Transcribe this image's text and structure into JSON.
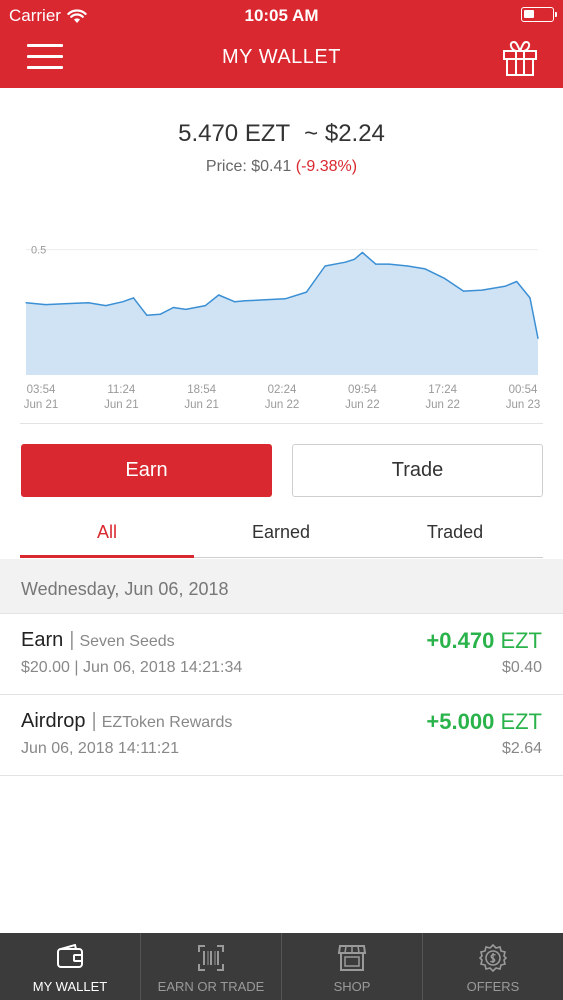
{
  "status_bar": {
    "carrier": "Carrier",
    "time": "10:05 AM"
  },
  "nav": {
    "title": "MY WALLET",
    "menu_icon": "hamburger-menu-icon",
    "right_icon": "gift-icon"
  },
  "balance": {
    "amount": "5.470 EZT",
    "fiat": "~ $2.24"
  },
  "price": {
    "label": "Price: $0.41",
    "change": "(-9.38%)"
  },
  "chart_data": {
    "type": "area",
    "title": "",
    "xlabel": "",
    "ylabel": "",
    "y_ticks": [
      "0.5",
      "0.4"
    ],
    "ylim": [
      0.37,
      0.51
    ],
    "x_ticks": [
      {
        "time": "03:54",
        "date": "Jun 21"
      },
      {
        "time": "11:24",
        "date": "Jun 21"
      },
      {
        "time": "18:54",
        "date": "Jun 21"
      },
      {
        "time": "02:24",
        "date": "Jun 22"
      },
      {
        "time": "09:54",
        "date": "Jun 22"
      },
      {
        "time": "17:24",
        "date": "Jun 22"
      },
      {
        "time": "00:54",
        "date": "Jun 23"
      }
    ],
    "x": [
      "Jun 21 03:54",
      "Jun 21 05:45",
      "Jun 21 07:45",
      "Jun 21 09:45",
      "Jun 21 11:24",
      "Jun 21 13:00",
      "Jun 21 14:00",
      "Jun 21 15:15",
      "Jun 21 16:30",
      "Jun 21 17:45",
      "Jun 21 18:54",
      "Jun 21 20:45",
      "Jun 21 22:00",
      "Jun 21 23:30",
      "Jun 22 00:30",
      "Jun 22 02:24",
      "Jun 22 04:15",
      "Jun 22 06:15",
      "Jun 22 08:00",
      "Jun 22 09:54",
      "Jun 22 10:45",
      "Jun 22 11:30",
      "Jun 22 12:45",
      "Jun 22 14:00",
      "Jun 22 15:45",
      "Jun 22 17:24",
      "Jun 22 19:15",
      "Jun 22 21:00",
      "Jun 22 22:45",
      "Jun 23 00:54",
      "Jun 23 02:00",
      "Jun 23 03:15",
      "Jun 23 04:00"
    ],
    "values": [
      0.445,
      0.443,
      0.444,
      0.445,
      0.442,
      0.446,
      0.45,
      0.432,
      0.433,
      0.44,
      0.438,
      0.442,
      0.453,
      0.446,
      0.447,
      0.448,
      0.449,
      0.456,
      0.483,
      0.487,
      0.49,
      0.497,
      0.485,
      0.485,
      0.483,
      0.48,
      0.47,
      0.457,
      0.458,
      0.462,
      0.467,
      0.45,
      0.408
    ],
    "color": "#3b8fd4",
    "fill": "#cfe3f5",
    "grid": true
  },
  "actions": {
    "earn": "Earn",
    "trade": "Trade"
  },
  "tabs": [
    {
      "label": "All",
      "active": true
    },
    {
      "label": "Earned",
      "active": false
    },
    {
      "label": "Traded",
      "active": false
    }
  ],
  "section_date": "Wednesday, Jun 06, 2018",
  "transactions": [
    {
      "type": "Earn",
      "source": "Seven Seeds",
      "sub": "$20.00 | Jun 06, 2018  14:21:34",
      "amount": "+0.470",
      "unit": "EZT",
      "usd": "$0.40"
    },
    {
      "type": "Airdrop",
      "source": "EZToken Rewards",
      "sub": "Jun 06, 2018  14:11:21",
      "amount": "+5.000",
      "unit": "EZT",
      "usd": "$2.64"
    }
  ],
  "tabbar": [
    {
      "label": "MY WALLET",
      "icon": "wallet-icon",
      "active": true
    },
    {
      "label": "EARN OR TRADE",
      "icon": "barcode-scan-icon",
      "active": false
    },
    {
      "label": "SHOP",
      "icon": "store-icon",
      "active": false
    },
    {
      "label": "OFFERS",
      "icon": "coin-badge-icon",
      "active": false
    }
  ],
  "colors": {
    "brand_red": "#d9282f",
    "positive_green": "#2bb34b",
    "tabbar_bg": "#3b3b3b"
  }
}
